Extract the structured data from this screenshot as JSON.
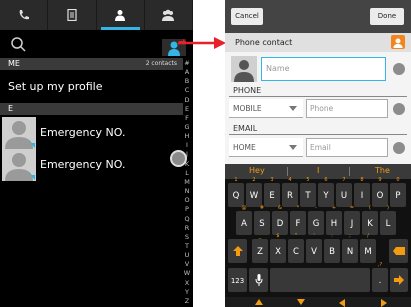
{
  "left_phone": {
    "tabs": [
      {
        "icon": "phone-icon"
      },
      {
        "icon": "call-log-icon"
      },
      {
        "icon": "person-icon",
        "active": true
      },
      {
        "icon": "group-icon"
      }
    ],
    "search": {
      "icon": "search-icon"
    },
    "add_contact": {
      "icon": "add-contact-icon"
    },
    "me_header": "ME",
    "me_count": "2 contacts",
    "profile_label": "Set up my profile",
    "e_header": "E",
    "contacts": [
      {
        "name": "Emergency NO."
      },
      {
        "name": "Emergency NO."
      }
    ],
    "index_letters": [
      "#",
      "A",
      "B",
      "C",
      "D",
      "E",
      "F",
      "G",
      "H",
      "I",
      "J",
      "K",
      "L",
      "M",
      "N",
      "O",
      "P",
      "Q",
      "R",
      "S",
      "T",
      "U",
      "V",
      "W",
      "X",
      "Y",
      "Z"
    ]
  },
  "right_phone": {
    "cancel_label": "Cancel",
    "done_label": "Done",
    "phone_contact_label": "Phone contact",
    "name_placeholder": "Name",
    "phone_section": "PHONE",
    "phone_type": "MOBILE",
    "phone_placeholder": "Phone",
    "email_section": "EMAIL",
    "email_type": "HOME",
    "email_placeholder": "Email",
    "suggestions": [
      "Hey",
      "I",
      "The"
    ],
    "keyboard_rows": [
      [
        {
          "k": "Q",
          "a": "1"
        },
        {
          "k": "W",
          "a": "2"
        },
        {
          "k": "E",
          "a": "3"
        },
        {
          "k": "R",
          "a": "4"
        },
        {
          "k": "T",
          "a": "5"
        },
        {
          "k": "Y",
          "a": "6"
        },
        {
          "k": "U",
          "a": "7"
        },
        {
          "k": "I",
          "a": "8"
        },
        {
          "k": "O",
          "a": "9"
        },
        {
          "k": "P",
          "a": "0"
        }
      ],
      [
        {
          "k": "A",
          "a": "@"
        },
        {
          "k": "S",
          "a": "#"
        },
        {
          "k": "D",
          "a": "&"
        },
        {
          "k": "F",
          "a": "*"
        },
        {
          "k": "G",
          "a": "-"
        },
        {
          "k": "H",
          "a": "+"
        },
        {
          "k": "J",
          "a": "="
        },
        {
          "k": "K",
          "a": "("
        },
        {
          "k": "L",
          "a": ")"
        }
      ],
      [
        {
          "k": "Z",
          "a": "_"
        },
        {
          "k": "X",
          "a": "$"
        },
        {
          "k": "C",
          "a": "\""
        },
        {
          "k": "V",
          "a": "'"
        },
        {
          "k": "B",
          "a": ":"
        },
        {
          "k": "N",
          "a": ";"
        },
        {
          "k": "M",
          "a": "/"
        }
      ]
    ],
    "symbols_key": "123",
    "mic_icon": "mic-icon",
    "punct_key": ".",
    "punct_alt": ",?",
    "accent_color": "#f39c12",
    "focus_color": "#33b5e5"
  },
  "arrow_color": "#e8202a"
}
